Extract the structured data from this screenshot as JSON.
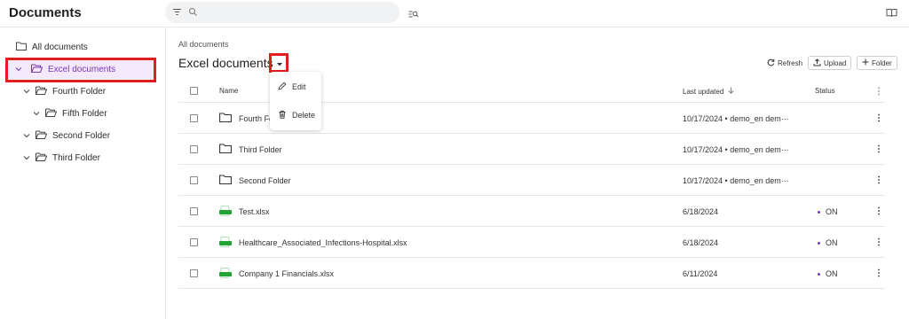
{
  "app": {
    "title": "Documents"
  },
  "search": {
    "placeholder": "",
    "value": ""
  },
  "sidebar": {
    "items": [
      {
        "label": "All documents"
      },
      {
        "label": "Excel documents"
      },
      {
        "label": "Fourth Folder"
      },
      {
        "label": "Fifth Folder"
      },
      {
        "label": "Second Folder"
      },
      {
        "label": "Third Folder"
      }
    ]
  },
  "main": {
    "breadcrumb": "All documents",
    "title": "Excel documents",
    "actions": {
      "refresh": "Refresh",
      "upload": "Upload",
      "folder": "Folder"
    },
    "columns": {
      "name": "Name",
      "last_updated": "Last updated",
      "status": "Status"
    },
    "rows": [
      {
        "name": "Fourth Fo",
        "type": "folder",
        "updated": "10/17/2024 • demo_en dem···",
        "status": ""
      },
      {
        "name": "Third Folder",
        "type": "folder",
        "updated": "10/17/2024 • demo_en dem···",
        "status": ""
      },
      {
        "name": "Second Folder",
        "type": "folder",
        "updated": "10/17/2024 • demo_en dem···",
        "status": ""
      },
      {
        "name": "Test.xlsx",
        "type": "xlsx",
        "updated": "6/18/2024",
        "status": "ON"
      },
      {
        "name": "Healthcare_Associated_Infections-Hospital.xlsx",
        "type": "xlsx",
        "updated": "6/18/2024",
        "status": "ON"
      },
      {
        "name": "Company 1 Financials.xlsx",
        "type": "xlsx",
        "updated": "6/11/2024",
        "status": "ON"
      }
    ]
  },
  "menu": {
    "edit": "Edit",
    "delete": "Delete"
  },
  "colors": {
    "accent": "#7a36b8",
    "selected_bg": "#f3e9fb",
    "highlight": "#e01e1e",
    "xlsx": "#21a336"
  }
}
